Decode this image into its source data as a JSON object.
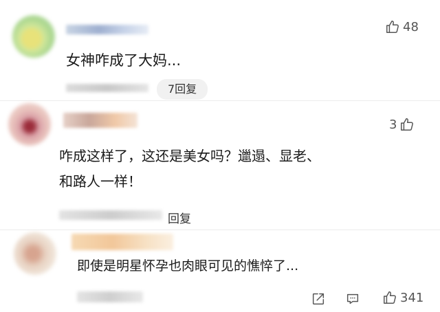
{
  "comments": [
    {
      "text": "女神咋成了大妈...",
      "likes": "48",
      "reply_label": "7回复"
    },
    {
      "text_line1": "咋成这样了，这还是美女吗？邋遢、显老、",
      "text_line2": "和路人一样！",
      "likes": "3",
      "reply_label": "回复"
    },
    {
      "text": "即使是明星怀孕也肉眼可见的憔悴了...",
      "likes": "341"
    }
  ],
  "icons": {
    "like": "thumbs-up-icon",
    "share": "share-icon",
    "comment": "comment-icon"
  },
  "colors": {
    "text": "#1a1a1a",
    "muted": "#555555",
    "pill_bg": "#f1f1f1"
  }
}
